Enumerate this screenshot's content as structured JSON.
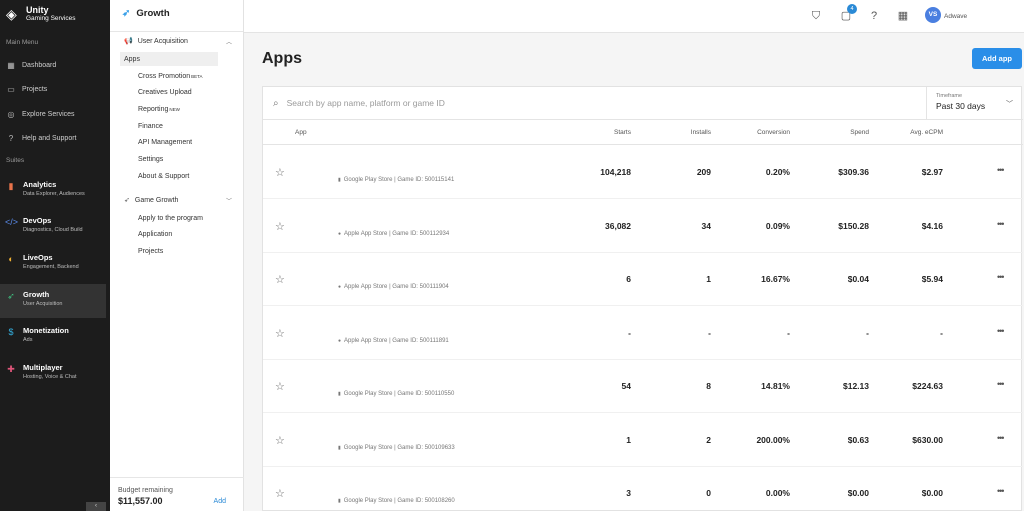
{
  "nav": {
    "logo_line1": "Unity",
    "logo_line2": "Gaming Services",
    "main_menu_label": "Main Menu",
    "main_items": [
      {
        "label": "Dashboard",
        "icon": "grid-icon"
      },
      {
        "label": "Projects",
        "icon": "folder-icon"
      },
      {
        "label": "Explore Services",
        "icon": "compass-icon"
      },
      {
        "label": "Help and Support",
        "icon": "help-icon"
      }
    ],
    "suites_label": "Suites",
    "suites": [
      {
        "name": "Analytics",
        "sub": "Data Explorer, Audiences",
        "icon": "bar-chart-icon",
        "color": "#e8734a"
      },
      {
        "name": "DevOps",
        "sub": "Diagnostics, Cloud Build",
        "icon": "code-icon",
        "color": "#5b8def"
      },
      {
        "name": "LiveOps",
        "sub": "Engagement, Backend",
        "icon": "live-icon",
        "color": "#f2b233"
      },
      {
        "name": "Growth",
        "sub": "User Acquisition",
        "icon": "rocket-icon",
        "color": "#3fbf7f"
      },
      {
        "name": "Monetization",
        "sub": "Ads",
        "icon": "coin-icon",
        "color": "#34b3e4"
      },
      {
        "name": "Multiplayer",
        "sub": "Hosting, Voice & Chat",
        "icon": "gamepad-icon",
        "color": "#e0557a"
      }
    ]
  },
  "subnav": {
    "title": "Growth",
    "group1": "User Acquisition",
    "group1_items": [
      {
        "label": "Apps",
        "sup": ""
      },
      {
        "label": "Cross Promotion",
        "sup": "BETA"
      },
      {
        "label": "Creatives Upload",
        "sup": ""
      },
      {
        "label": "Reporting",
        "sup": "NEW"
      },
      {
        "label": "Finance",
        "sup": ""
      },
      {
        "label": "API Management",
        "sup": ""
      },
      {
        "label": "Settings",
        "sup": ""
      },
      {
        "label": "About & Support",
        "sup": ""
      }
    ],
    "group2": "Game Growth",
    "group2_items": [
      {
        "label": "Apply to the program"
      },
      {
        "label": "Application"
      },
      {
        "label": "Projects"
      }
    ],
    "budget_label": "Budget remaining",
    "budget_value": "$11,557.00",
    "budget_add": "Add"
  },
  "topbar": {
    "notification_count": "4",
    "avatar_initials": "VS",
    "org_name": "Adwave"
  },
  "main": {
    "title": "Apps",
    "add_app_label": "Add app",
    "search_placeholder": "Search by app name, platform or game ID",
    "timeframe_label": "Timeframe",
    "timeframe_value": "Past 30 days",
    "columns": {
      "app": "App",
      "starts": "Starts",
      "installs": "Installs",
      "conversion": "Conversion",
      "spend": "Spend",
      "ecpm": "Avg. eCPM"
    },
    "rows": [
      {
        "meta": "Google Play Store | Game ID: 500115141",
        "starts": "104,218",
        "installs": "209",
        "conversion": "0.20%",
        "spend": "$309.36",
        "ecpm": "$2.97"
      },
      {
        "meta": "Apple App Store | Game ID: 500112934",
        "starts": "36,082",
        "installs": "34",
        "conversion": "0.09%",
        "spend": "$150.28",
        "ecpm": "$4.16"
      },
      {
        "meta": "Apple App Store | Game ID: 500111904",
        "starts": "6",
        "installs": "1",
        "conversion": "16.67%",
        "spend": "$0.04",
        "ecpm": "$5.94"
      },
      {
        "meta": "Apple App Store | Game ID: 500111891",
        "starts": "-",
        "installs": "-",
        "conversion": "-",
        "spend": "-",
        "ecpm": "-"
      },
      {
        "meta": "Google Play Store | Game ID: 500110550",
        "starts": "54",
        "installs": "8",
        "conversion": "14.81%",
        "spend": "$12.13",
        "ecpm": "$224.63"
      },
      {
        "meta": "Google Play Store | Game ID: 500109633",
        "starts": "1",
        "installs": "2",
        "conversion": "200.00%",
        "spend": "$0.63",
        "ecpm": "$630.00"
      },
      {
        "meta": "Google Play Store | Game ID: 500108260",
        "starts": "3",
        "installs": "0",
        "conversion": "0.00%",
        "spend": "$0.00",
        "ecpm": "$0.00"
      }
    ]
  }
}
